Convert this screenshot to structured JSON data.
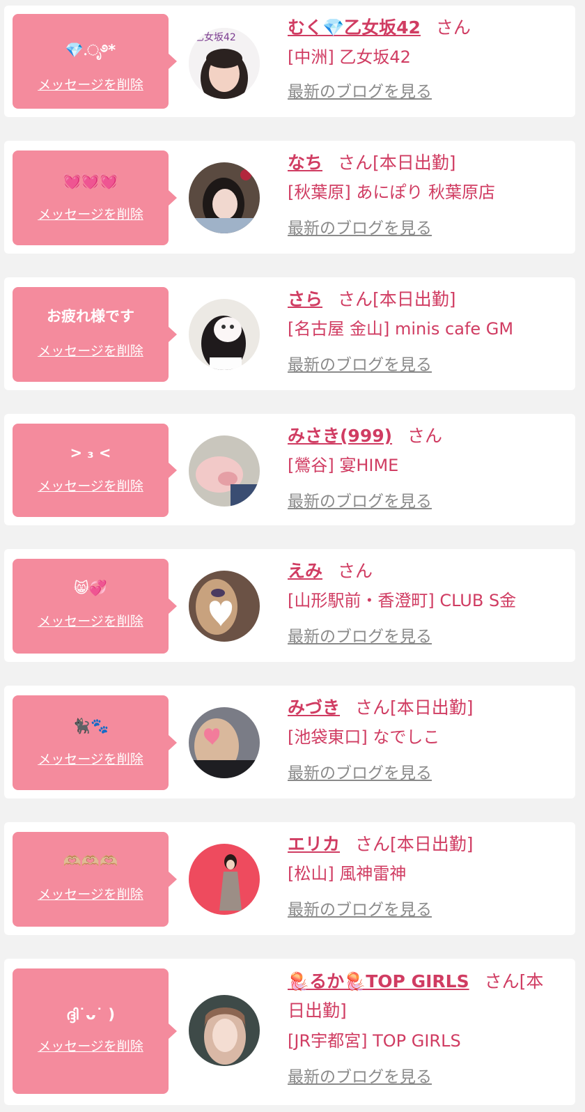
{
  "colors": {
    "accent": "#d03c62",
    "bubble": "#f48b9d",
    "muted": "#8a8a8a",
    "page_bg": "#f2f2f2",
    "card_bg": "#ffffff"
  },
  "delete_label": "メッセージを削除",
  "blog_label": "最新のブログを見る",
  "entries": [
    {
      "message": "💎.ೃ࿔*",
      "name": "むく💎乙女坂42",
      "suffix": "さん",
      "shop": "[中洲] 乙女坂42",
      "avatar_text": "乙女坂42"
    },
    {
      "message": "💓💓💓",
      "name": "なち",
      "suffix": "さん[本日出勤]",
      "shop": "[秋葉原] あにぽり 秋葉原店"
    },
    {
      "message": "お疲れ様です",
      "name": "さら",
      "suffix": "さん[本日出勤]",
      "shop": "[名古屋 金山] minis cafe GM"
    },
    {
      "message": "> ₃ <",
      "name": "みさき(999)",
      "suffix": "さん",
      "shop": "[鶯谷] 宴HIME"
    },
    {
      "message": "😸💞",
      "name": "えみ",
      "suffix": "さん",
      "shop": "[山形駅前・香澄町] CLUB S金"
    },
    {
      "message": "🐈‍⬛🐾",
      "name": "みづき",
      "suffix": "さん[本日出勤]",
      "shop": "[池袋東口] なでしこ"
    },
    {
      "message": "🫶🏼🫶🏼🫶🏼",
      "name": "エリカ",
      "suffix": "さん[本日出勤]",
      "shop": "[松山] 風神雷神"
    },
    {
      "message": "ദ്ദി˙ᴗ˙ )",
      "name": "🪼るか🪼TOP GIRLS",
      "suffix": "さん[本日出勤]",
      "shop": "[JR宇都宮] TOP GIRLS"
    }
  ]
}
